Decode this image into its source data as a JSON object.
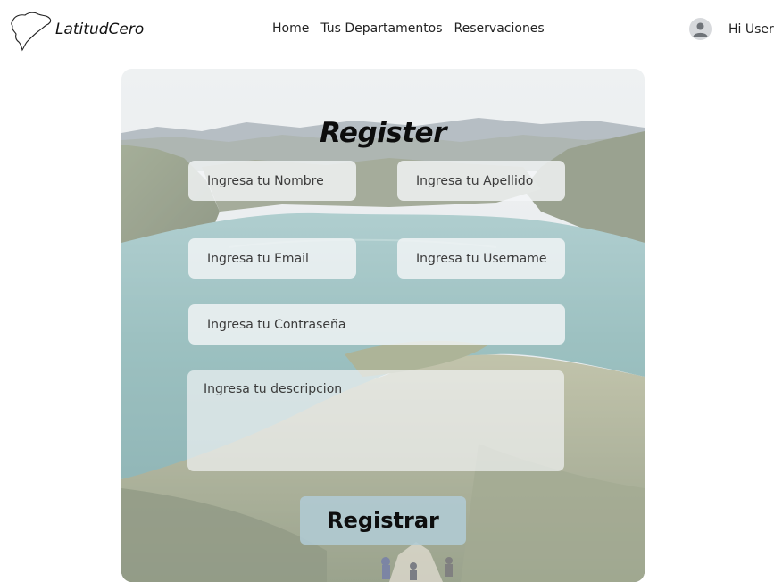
{
  "brand": {
    "name": "LatitudCero",
    "logo_icon": "ecuador-map-outline-icon"
  },
  "nav": {
    "links": [
      {
        "label": "Home"
      },
      {
        "label": "Tus Departamentos"
      },
      {
        "label": "Reservaciones"
      }
    ]
  },
  "user": {
    "avatar_icon": "user-avatar-icon",
    "greeting": "Hi User"
  },
  "form": {
    "title": "Register",
    "background": "crater-lake-landscape",
    "fields": {
      "first_name": {
        "placeholder": "Ingresa tu Nombre",
        "value": ""
      },
      "last_name": {
        "placeholder": "Ingresa tu Apellido",
        "value": ""
      },
      "email": {
        "placeholder": "Ingresa tu Email",
        "value": ""
      },
      "username": {
        "placeholder": "Ingresa tu Username",
        "value": ""
      },
      "password": {
        "placeholder": "Ingresa tu Contraseña",
        "value": ""
      },
      "description": {
        "placeholder": "Ingresa tu descripcion",
        "value": ""
      }
    },
    "submit_label": "Registrar"
  },
  "colors": {
    "button_bg": "#b0cbd4",
    "field_bg": "#f3f5f6",
    "lake": "#5f9a9a",
    "text": "#0d0d0d"
  }
}
